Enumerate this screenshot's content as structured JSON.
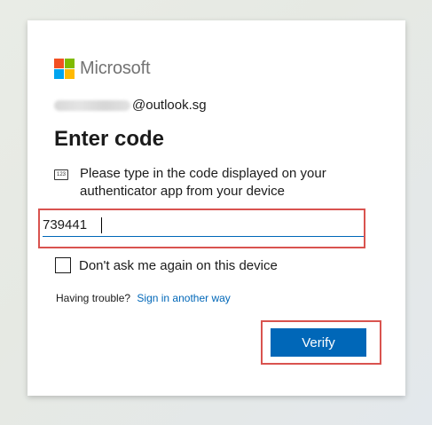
{
  "brand": {
    "name": "Microsoft",
    "logo_colors": [
      "#f25022",
      "#7fba00",
      "#00a4ef",
      "#ffb900"
    ]
  },
  "identity": {
    "email_suffix": "@outlook.sg"
  },
  "page": {
    "title": "Enter code"
  },
  "instruction": {
    "icon_text": "123",
    "text": "Please type in the code displayed on your authenticator app from your device"
  },
  "code_input": {
    "value": "739441"
  },
  "remember": {
    "label": "Don't ask me again on this device",
    "checked": false
  },
  "trouble": {
    "prefix": "Having trouble?",
    "link": "Sign in another way"
  },
  "actions": {
    "verify_label": "Verify"
  },
  "colors": {
    "accent": "#0067b8",
    "highlight": "#d9534f"
  }
}
